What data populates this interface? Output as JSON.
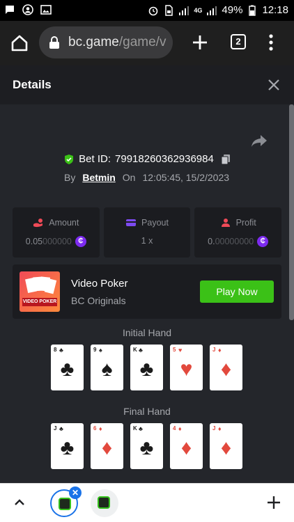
{
  "status_bar": {
    "battery": "49%",
    "time": "12:18",
    "network": "4G"
  },
  "browser": {
    "url_main": "bc.game",
    "url_rest": "/game/v",
    "tab_count": "2"
  },
  "details": {
    "title": "Details",
    "bet_id_label": "Bet ID:",
    "bet_id": "79918260362936984",
    "by_label": "By",
    "user": "Betmin",
    "on_label": "On",
    "datetime": "12:05:45, 15/2/2023"
  },
  "stats": {
    "amount": {
      "label": "Amount",
      "value_main": "0.05",
      "value_zeros": "000000"
    },
    "payout": {
      "label": "Payout",
      "value": "1 x"
    },
    "profit": {
      "label": "Profit",
      "value_main": "0.",
      "value_zeros": "00000000"
    },
    "coin_symbol": "₵"
  },
  "game": {
    "thumb_text": "VIDEO POKER",
    "name": "Video Poker",
    "provider": "BC Originals",
    "play_label": "Play Now"
  },
  "initial_hand": {
    "label": "Initial Hand",
    "cards": [
      {
        "rank": "8",
        "suit": "♣",
        "color": "black"
      },
      {
        "rank": "9",
        "suit": "♠",
        "color": "black"
      },
      {
        "rank": "K",
        "suit": "♣",
        "color": "black"
      },
      {
        "rank": "5",
        "suit": "♥",
        "color": "red"
      },
      {
        "rank": "J",
        "suit": "♦",
        "color": "red"
      }
    ]
  },
  "final_hand": {
    "label": "Final Hand",
    "cards": [
      {
        "rank": "J",
        "suit": "♣",
        "color": "black"
      },
      {
        "rank": "6",
        "suit": "♦",
        "color": "red"
      },
      {
        "rank": "K",
        "suit": "♣",
        "color": "black"
      },
      {
        "rank": "4",
        "suit": "♦",
        "color": "red"
      },
      {
        "rank": "J",
        "suit": "♦",
        "color": "red"
      }
    ]
  },
  "colors": {
    "accent_green": "#3bc117",
    "coin_purple": "#7d2bf0",
    "bg": "#24262b"
  }
}
